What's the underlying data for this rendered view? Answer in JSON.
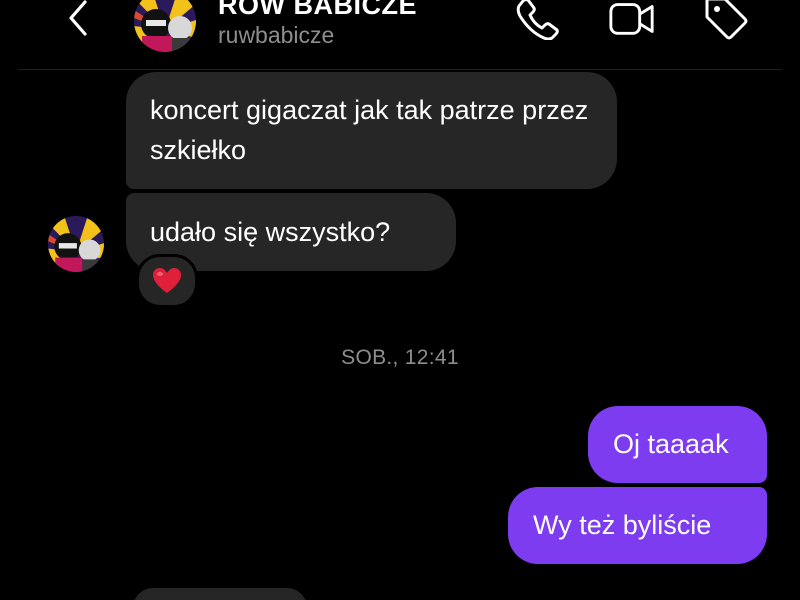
{
  "header": {
    "title": "RÓW BABICZE",
    "username": "ruwbabicze",
    "back_icon": "chevron-left-icon",
    "actions": [
      {
        "name": "call",
        "icon": "phone-icon"
      },
      {
        "name": "video",
        "icon": "video-camera-icon"
      },
      {
        "name": "tag",
        "icon": "tag-icon"
      }
    ]
  },
  "messages": [
    {
      "direction": "incoming",
      "text": "koncert gigaczat jak tak patrze przez szkiełko"
    },
    {
      "direction": "incoming",
      "text": "udało się wszystko?",
      "reaction": "❤️"
    },
    {
      "direction": "outgoing",
      "text": "Oj taaaak"
    },
    {
      "direction": "outgoing",
      "text": "Wy też byliście"
    }
  ],
  "timestamp": "SOB., 12:41",
  "colors": {
    "background": "#000000",
    "incoming_bubble": "#262626",
    "outgoing_bubble": "#7d3cf0",
    "secondary_text": "#8e8e8e",
    "reaction_heart": "#e0203a"
  }
}
